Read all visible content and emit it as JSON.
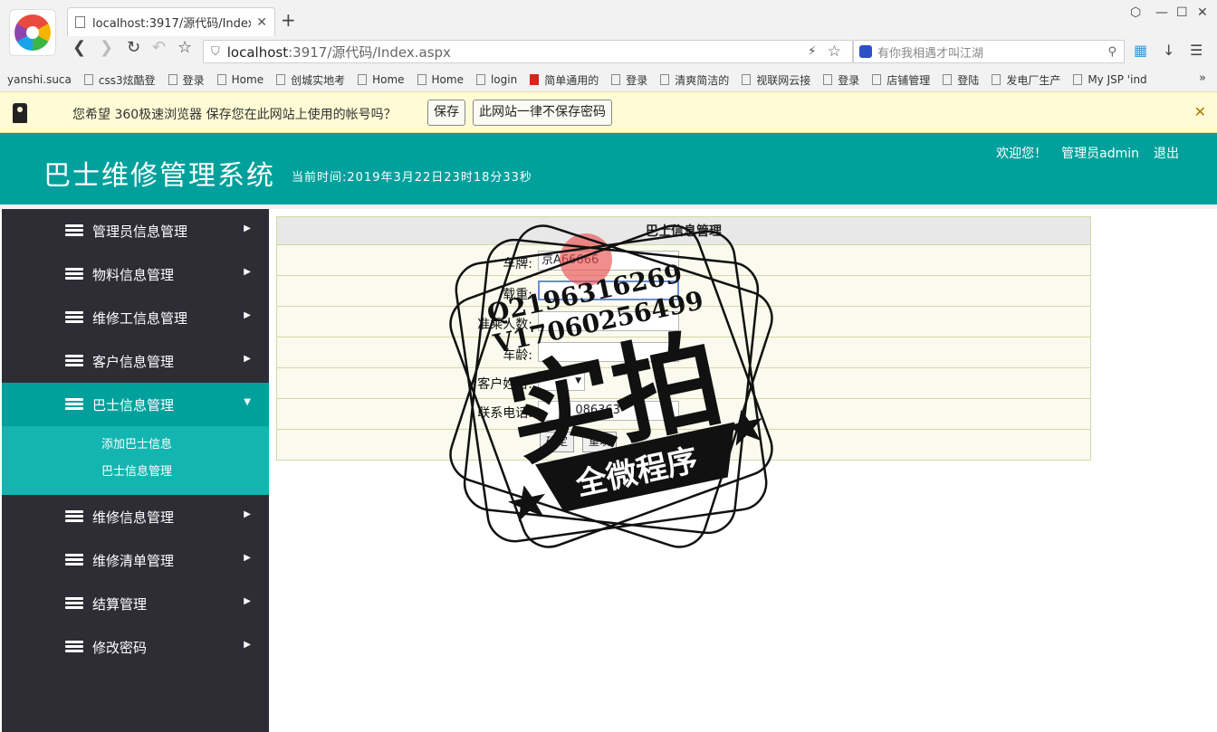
{
  "browser": {
    "tab_title": "localhost:3917/源代码/Index.a",
    "address": {
      "host": "localhost",
      "rest": ":3917/源代码/Index.aspx"
    },
    "search_placeholder": "有你我相遇才叫江湖",
    "bookmarks": [
      {
        "label": "yanshi.suca",
        "icon": "none"
      },
      {
        "label": "css3炫酷登",
        "icon": "page"
      },
      {
        "label": "登录",
        "icon": "page"
      },
      {
        "label": "Home",
        "icon": "page"
      },
      {
        "label": "创城实地考",
        "icon": "page"
      },
      {
        "label": "Home",
        "icon": "page"
      },
      {
        "label": "Home",
        "icon": "page"
      },
      {
        "label": "login",
        "icon": "page"
      },
      {
        "label": "简单通用的",
        "icon": "red"
      },
      {
        "label": "登录",
        "icon": "page"
      },
      {
        "label": "清爽简洁的",
        "icon": "page"
      },
      {
        "label": "视联网云接",
        "icon": "page"
      },
      {
        "label": "登录",
        "icon": "page"
      },
      {
        "label": "店铺管理",
        "icon": "page"
      },
      {
        "label": "登陆",
        "icon": "page"
      },
      {
        "label": "发电厂生产",
        "icon": "page"
      },
      {
        "label": "My JSP 'ind",
        "icon": "page"
      }
    ],
    "infobar": {
      "message": "您希望 360极速浏览器 保存您在此网站上使用的帐号吗？",
      "save": "保存",
      "never": "此网站一律不保存密码"
    }
  },
  "header": {
    "title": "巴士维修管理系统",
    "time": "当前时间:2019年3月22日23时18分33秒",
    "welcome": "欢迎您！",
    "user": "管理员admin",
    "logout": "退出"
  },
  "sidebar": {
    "items": [
      {
        "label": "管理员信息管理"
      },
      {
        "label": "物料信息管理"
      },
      {
        "label": "维修工信息管理"
      },
      {
        "label": "客户信息管理"
      },
      {
        "label": "巴士信息管理"
      },
      {
        "label": "维修信息管理"
      },
      {
        "label": "维修清单管理"
      },
      {
        "label": "结算管理"
      },
      {
        "label": "修改密码"
      }
    ],
    "active_index": 4,
    "submenu": [
      "添加巴士信息",
      "巴士信息管理"
    ]
  },
  "form": {
    "title": "巴士信息管理",
    "plate_label": "车牌:",
    "plate_value": "京A66666",
    "load_label": "载重:",
    "load_value": "",
    "passengers_label": "准乘人数:",
    "age_label": "车龄:",
    "customer_label": "客户姓名:",
    "customer_value": "",
    "phone_label": "联系电话:",
    "phone_value": "086363",
    "submit": "确定",
    "reset": "重填"
  },
  "watermark": {
    "line1": "Q2196316269",
    "line2": "V17060256499",
    "big": "实拍",
    "banner": "全微程序"
  },
  "colors": {
    "teal": "#00a19c",
    "sidebar": "#2e2d36",
    "submenu": "#14b5b0"
  }
}
